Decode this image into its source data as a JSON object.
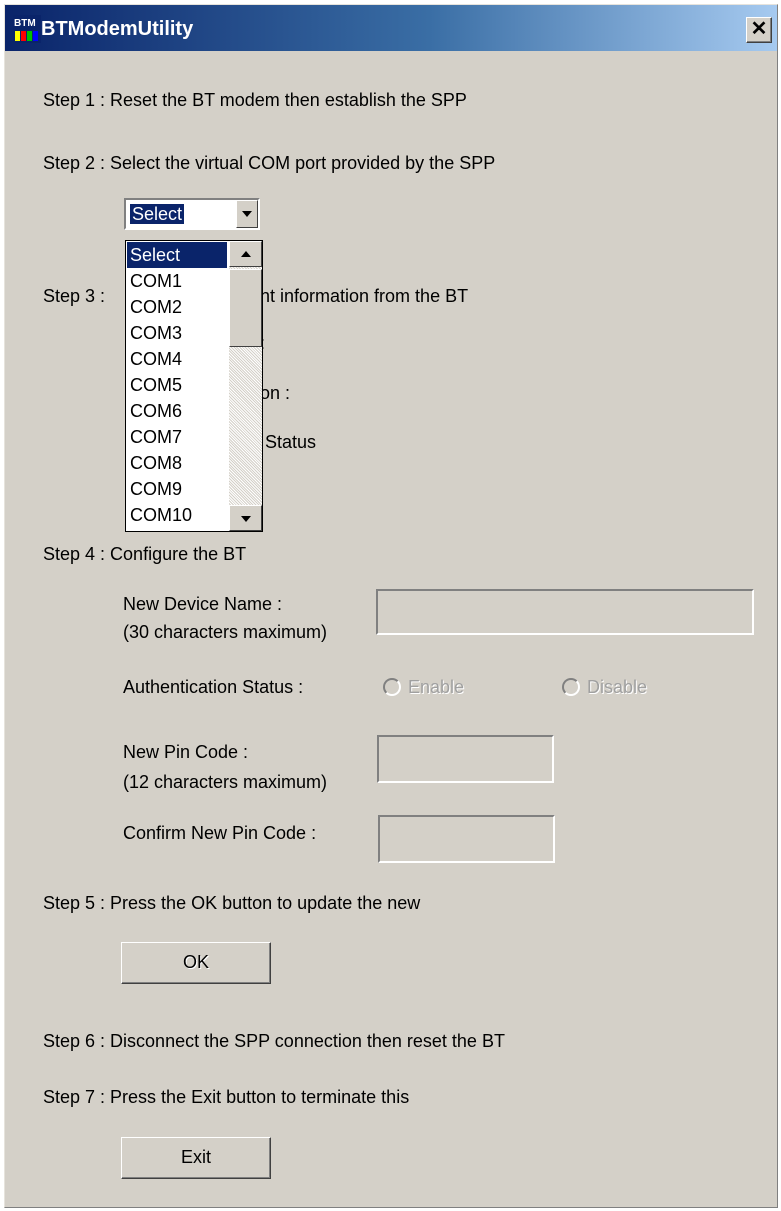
{
  "window": {
    "title": "BTModemUtility",
    "icon_text": "BTM",
    "close_glyph": "✕"
  },
  "steps": {
    "step1": "Step 1 : Reset the BT modem then establish the SPP",
    "step2": "Step 2 : Select the virtual COM port provided by the SPP",
    "step3_prefix": "Step 3 :",
    "step3_tail": "nt information from the BT",
    "step3_row1_tail": ":",
    "step3_row2_tail": "on :",
    "step3_row3_tail": "Status",
    "step4": "Step 4 : Configure the BT",
    "step5": "Step 5 : Press the OK button to update the new",
    "step6": "Step 6 : Disconnect the SPP connection then reset the BT",
    "step7": "Step 7 : Press the Exit button to terminate this"
  },
  "com_port": {
    "selected": "Select",
    "options": [
      "Select",
      "COM1",
      "COM2",
      "COM3",
      "COM4",
      "COM5",
      "COM6",
      "COM7",
      "COM8",
      "COM9",
      "COM10"
    ],
    "highlighted_index": 0
  },
  "configure": {
    "device_name_label": "New Device Name :",
    "device_name_hint": "(30 characters maximum)",
    "device_name_value": "",
    "auth_label": "Authentication Status :",
    "auth_enable": "Enable",
    "auth_disable": "Disable",
    "pin_label": "New Pin Code :",
    "pin_hint": "(12 characters maximum)",
    "pin_value": "",
    "confirm_pin_label": "Confirm New Pin Code :",
    "confirm_pin_value": ""
  },
  "buttons": {
    "ok_label": "OK",
    "exit_label": "Exit"
  },
  "colors": {
    "title_bar_start": "#0a246a",
    "title_bar_end": "#a6caf0",
    "dialog_face": "#d4d0c8",
    "selection": "#0a246a",
    "disabled_text": "#a0a0a0"
  },
  "icons": [
    "btm-app-icon",
    "close-icon",
    "chevron-down-icon",
    "chevron-up-icon"
  ]
}
